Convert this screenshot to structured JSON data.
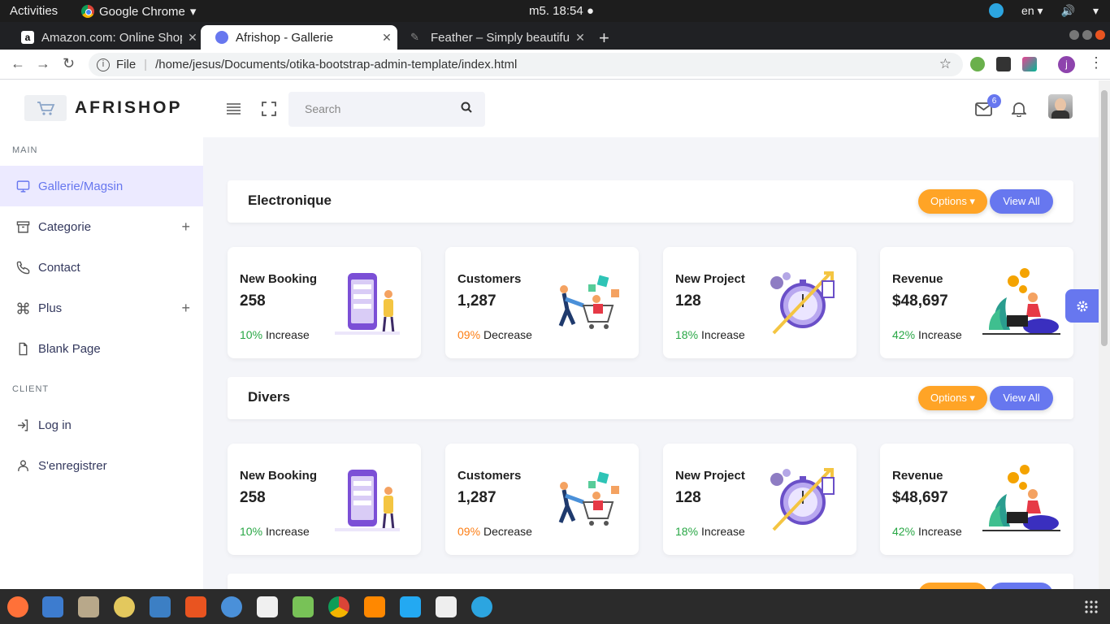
{
  "system_bar": {
    "activities": "Activities",
    "app_name": "Google Chrome",
    "clock": "m5. 18:54 ●",
    "language": "en"
  },
  "browser": {
    "tabs": [
      {
        "title": "Amazon.com: Online Shopping",
        "favicon_color": "#ffffff"
      },
      {
        "title": "Afrishop - Gallerie",
        "favicon_color": "#6777ef"
      },
      {
        "title": "Feather – Simply beautiful open source icons",
        "favicon_color": "#888888"
      }
    ],
    "new_tab": "+",
    "url_scheme": "File",
    "url": "/home/jesus/Documents/otika-bootstrap-admin-template/index.html",
    "profile_initial": "j"
  },
  "sidebar": {
    "brand": "AFRISHOP",
    "sections": [
      {
        "header": "MAIN"
      },
      {
        "header": "CLIENT"
      }
    ],
    "items": [
      {
        "label": "Gallerie/Magsin",
        "icon": "monitor-icon",
        "active": true
      },
      {
        "label": "Categorie",
        "icon": "archive-icon",
        "expand": "+"
      },
      {
        "label": "Contact",
        "icon": "phone-icon"
      },
      {
        "label": "Plus",
        "icon": "command-icon",
        "expand": "+"
      },
      {
        "label": "Blank Page",
        "icon": "file-icon"
      },
      {
        "label": "Log in",
        "icon": "log-in-icon"
      },
      {
        "label": "S'enregistrer",
        "icon": "user-icon"
      }
    ]
  },
  "header": {
    "search_placeholder": "Search",
    "mail_count": "6"
  },
  "sections": [
    {
      "title": "Electronique",
      "options_label": "Options ▾",
      "view_all_label": "View All",
      "cards": [
        {
          "label": "New Booking",
          "value": "258",
          "pct": "10%",
          "trend": "Increase",
          "pct_color": "#28a745"
        },
        {
          "label": "Customers",
          "value": "1,287",
          "pct": "09%",
          "trend": "Decrease",
          "pct_color": "#fd7e14"
        },
        {
          "label": "New Project",
          "value": "128",
          "pct": "18%",
          "trend": "Increase",
          "pct_color": "#28a745"
        },
        {
          "label": "Revenue",
          "value": "$48,697",
          "pct": "42%",
          "trend": "Increase",
          "pct_color": "#28a745"
        }
      ]
    },
    {
      "title": "Divers",
      "options_label": "Options ▾",
      "view_all_label": "View All",
      "cards": [
        {
          "label": "New Booking",
          "value": "258",
          "pct": "10%",
          "trend": "Increase",
          "pct_color": "#28a745"
        },
        {
          "label": "Customers",
          "value": "1,287",
          "pct": "09%",
          "trend": "Decrease",
          "pct_color": "#fd7e14"
        },
        {
          "label": "New Project",
          "value": "128",
          "pct": "18%",
          "trend": "Increase",
          "pct_color": "#28a745"
        },
        {
          "label": "Revenue",
          "value": "$48,697",
          "pct": "42%",
          "trend": "Increase",
          "pct_color": "#28a745"
        }
      ]
    }
  ],
  "dock": {
    "apps": [
      {
        "name": "firefox-icon",
        "color": "#ff7139"
      },
      {
        "name": "thunderbird-icon",
        "color": "#3d7ccf"
      },
      {
        "name": "files-icon",
        "color": "#b8a88a"
      },
      {
        "name": "rhythmbox-icon",
        "color": "#e3c85d"
      },
      {
        "name": "writer-icon",
        "color": "#3c7fc4"
      },
      {
        "name": "software-icon",
        "color": "#e95420"
      },
      {
        "name": "help-icon",
        "color": "#4a90d9"
      },
      {
        "name": "amazon-icon",
        "color": "#f0f0f0"
      },
      {
        "name": "android-studio-icon",
        "color": "#78c257"
      },
      {
        "name": "chrome-icon",
        "color": "#4285f4"
      },
      {
        "name": "vlc-icon",
        "color": "#ff8800"
      },
      {
        "name": "vscode-icon",
        "color": "#23a9f2"
      },
      {
        "name": "draw-icon",
        "color": "#eeeeee"
      },
      {
        "name": "telegram-icon",
        "color": "#2ca5e0"
      }
    ]
  }
}
